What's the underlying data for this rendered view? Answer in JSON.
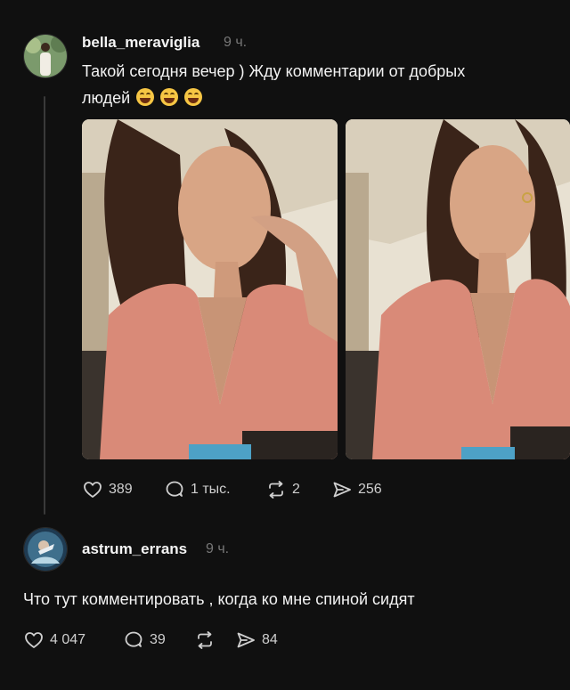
{
  "post": {
    "username": "bella_meraviglia",
    "time": "9 ч.",
    "text_line1": "Такой сегодня вечер ) Жду комментарии от добрых",
    "text_line2": "людей",
    "emojis": [
      "joy-emoji",
      "joy-emoji",
      "joy-emoji"
    ],
    "likes": "389",
    "comments": "1 тыс.",
    "reposts": "2",
    "shares": "256"
  },
  "reply": {
    "username": "astrum_errans",
    "time": "9 ч.",
    "text": "Что тут комментировать , когда ко мне спиной сидят",
    "likes": "4 047",
    "comments": "39",
    "reposts": "",
    "shares": "84"
  },
  "icons": {
    "like": "heart-icon",
    "comment": "comment-icon",
    "repost": "repost-icon",
    "share": "share-icon"
  },
  "colors": {
    "background": "#101010",
    "text": "#f3f3f3",
    "muted": "#777777",
    "dress": "#d98a78"
  }
}
